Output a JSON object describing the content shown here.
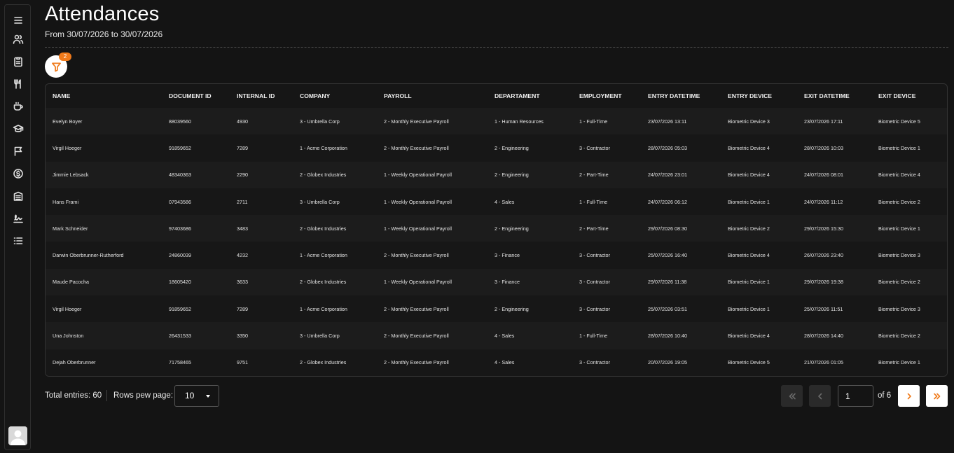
{
  "header": {
    "title": "Attendances",
    "subtitle": "From 30/07/2026 to 30/07/2026"
  },
  "filter": {
    "badge_count": "2",
    "icon": "filter-icon"
  },
  "sidebar": {
    "items": [
      {
        "name": "menu",
        "icon": "menu-icon"
      },
      {
        "name": "users",
        "icon": "users-icon"
      },
      {
        "name": "clipboard",
        "icon": "clipboard-icon"
      },
      {
        "name": "food",
        "icon": "utensils-icon"
      },
      {
        "name": "coffee",
        "icon": "coffee-icon"
      },
      {
        "name": "education",
        "icon": "graduation-cap-icon"
      },
      {
        "name": "flag",
        "icon": "flag-icon"
      },
      {
        "name": "payroll",
        "icon": "dollar-coin-icon"
      },
      {
        "name": "building",
        "icon": "building-icon"
      },
      {
        "name": "signature",
        "icon": "signature-icon"
      },
      {
        "name": "list",
        "icon": "list-icon"
      }
    ]
  },
  "table": {
    "columns": [
      "NAME",
      "DOCUMENT ID",
      "INTERNAL ID",
      "COMPANY",
      "PAYROLL",
      "DEPARTAMENT",
      "EMPLOYMENT",
      "ENTRY DATETIME",
      "ENTRY DEVICE",
      "EXIT DATETIME",
      "EXIT DEVICE"
    ],
    "rows": [
      [
        "Evelyn Boyer",
        "88039560",
        "4930",
        "3 - Umbrella Corp",
        "2 - Monthly Executive Payroll",
        "1 - Human Resources",
        "1 - Full-Time",
        "23/07/2026 13:11",
        "Biometric Device 3",
        "23/07/2026 17:11",
        "Biometric Device 5"
      ],
      [
        "Virgil Hoeger",
        "91859652",
        "7289",
        "1 - Acme Corporation",
        "2 - Monthly Executive Payroll",
        "2 - Engineering",
        "3 - Contractor",
        "28/07/2026 05:03",
        "Biometric Device 4",
        "28/07/2026 10:03",
        "Biometric Device 1"
      ],
      [
        "Jimmie Lebsack",
        "48340363",
        "2290",
        "2 - Globex Industries",
        "1 - Weekly Operational Payroll",
        "2 - Engineering",
        "2 - Part-Time",
        "24/07/2026 23:01",
        "Biometric Device 4",
        "24/07/2026 08:01",
        "Biometric Device 4"
      ],
      [
        "Hans Frami",
        "07943586",
        "2711",
        "3 - Umbrella Corp",
        "1 - Weekly Operational Payroll",
        "4 - Sales",
        "1 - Full-Time",
        "24/07/2026 06:12",
        "Biometric Device 1",
        "24/07/2026 11:12",
        "Biometric Device 2"
      ],
      [
        "Mark Schneider",
        "97403686",
        "3483",
        "2 - Globex Industries",
        "1 - Weekly Operational Payroll",
        "2 - Engineering",
        "2 - Part-Time",
        "29/07/2026 08:30",
        "Biometric Device 2",
        "29/07/2026 15:30",
        "Biometric Device 1"
      ],
      [
        "Darwin Oberbrunner-Rutherford",
        "24860039",
        "4232",
        "1 - Acme Corporation",
        "2 - Monthly Executive Payroll",
        "3 - Finance",
        "3 - Contractor",
        "25/07/2026 16:40",
        "Biometric Device 4",
        "26/07/2026 23:40",
        "Biometric Device 3"
      ],
      [
        "Maude Pacocha",
        "18605420",
        "3633",
        "2 - Globex Industries",
        "1 - Weekly Operational Payroll",
        "3 - Finance",
        "3 - Contractor",
        "29/07/2026 11:38",
        "Biometric Device 1",
        "29/07/2026 19:38",
        "Biometric Device 2"
      ],
      [
        "Virgil Hoeger",
        "91859652",
        "7289",
        "1 - Acme Corporation",
        "2 - Monthly Executive Payroll",
        "2 - Engineering",
        "3 - Contractor",
        "25/07/2026 03:51",
        "Biometric Device 1",
        "25/07/2026 11:51",
        "Biometric Device 3"
      ],
      [
        "Una Johnston",
        "26431533",
        "3350",
        "3 - Umbrella Corp",
        "2 - Monthly Executive Payroll",
        "4 - Sales",
        "1 - Full-Time",
        "28/07/2026 10:40",
        "Biometric Device 4",
        "28/07/2026 14:40",
        "Biometric Device 2"
      ],
      [
        "Dejah Oberbrunner",
        "71758465",
        "9751",
        "2 - Globex Industries",
        "2 - Monthly Executive Payroll",
        "4 - Sales",
        "3 - Contractor",
        "20/07/2026 19:05",
        "Biometric Device 5",
        "21/07/2026 01:05",
        "Biometric Device 1"
      ]
    ]
  },
  "footer": {
    "total_entries": "Total entries: 60",
    "rows_per_page_label": "Rows pew page:",
    "rows_per_page_value": "10",
    "current_page": "1",
    "of_pages": "of 6"
  },
  "colors": {
    "accent": "#f07a1a",
    "background": "#141414"
  }
}
